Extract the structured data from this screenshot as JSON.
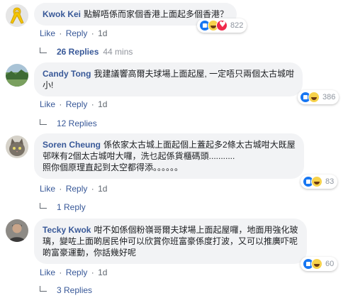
{
  "colors": {
    "author_link": "#385898",
    "bubble_bg": "#f2f3f5",
    "like_blue": "#1877f2",
    "love_red": "#f0284a",
    "haha_yellow": "#f7d24b"
  },
  "actions": {
    "like": "Like",
    "reply": "Reply",
    "separator": "·"
  },
  "comments": [
    {
      "author": "Kwok Kei",
      "avatar_icon": "yellow-ribbon-icon",
      "text_line1": "點解唔係而家個香港上面起多個香港？",
      "text_line2": "",
      "text_line3": "",
      "time": "1d",
      "reactions": [
        "like",
        "haha",
        "love"
      ],
      "reaction_count": "822",
      "replies_label": "26 Replies",
      "replies_time": "44 mins"
    },
    {
      "author": "Candy Tong",
      "avatar_icon": "landscape-photo-icon",
      "text_line1": "我建議響高爾夫球場上面起屋, 一定唔只兩個太古城咁",
      "text_line2": "小!",
      "text_line3": "",
      "time": "1d",
      "reactions": [
        "like",
        "haha"
      ],
      "reaction_count": "386",
      "replies_label": "12 Replies",
      "replies_time": ""
    },
    {
      "author": "Soren Cheung",
      "avatar_icon": "cat-photo-icon",
      "text_line1": "係依家太古城上面起個上蓋起多2條太古城咁大既屋",
      "text_line2": "邨咪有2個太古城咁大囉，洗乜起係貨櫃碼頭...........",
      "text_line3": "照你個原理直起到太空都得添。。。。。。",
      "time": "1d",
      "reactions": [
        "like",
        "haha"
      ],
      "reaction_count": "83",
      "replies_label": "1 Reply",
      "replies_time": ""
    },
    {
      "author": "Tecky Kwok",
      "avatar_icon": "person-photo-icon",
      "text_line1": "咁不如係個粉嶺哥爾夫球場上面起屋囉，地面用強化玻",
      "text_line2": "璃，變咗上面啲居民仲可以欣賞你班富豪係度打波，又可以推廣吓呢",
      "text_line3": "啲富豪運動，你話幾好呢",
      "time": "1d",
      "reactions": [
        "like",
        "haha"
      ],
      "reaction_count": "60",
      "replies_label": "3 Replies",
      "replies_time": ""
    }
  ]
}
